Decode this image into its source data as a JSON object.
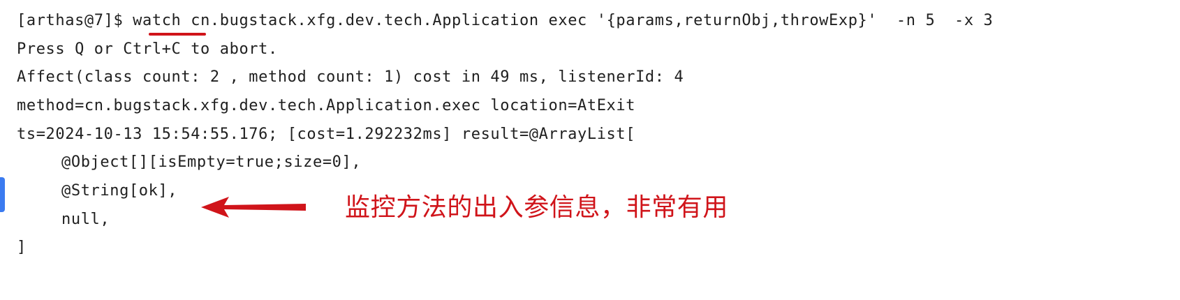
{
  "terminal": {
    "prompt": "[arthas@7]$ ",
    "command_keyword": "watch",
    "command_rest": " cn.bugstack.xfg.dev.tech.Application exec '{params,returnObj,throwExp}'  -n 5  -x 3",
    "lines": [
      "Press Q or Ctrl+C to abort.",
      "Affect(class count: 2 , method count: 1) cost in 49 ms, listenerId: 4",
      "method=cn.bugstack.xfg.dev.tech.Application.exec location=AtExit",
      "ts=2024-10-13 15:54:55.176; [cost=1.292232ms] result=@ArrayList["
    ],
    "result_items": [
      "@Object[][isEmpty=true;size=0],",
      "@String[ok],",
      "null,"
    ],
    "closing": "]"
  },
  "annotation": {
    "text": "监控方法的出入参信息，非常有用",
    "color": "#d0141a"
  },
  "icons": {
    "arrow": "arrow-left-icon"
  }
}
